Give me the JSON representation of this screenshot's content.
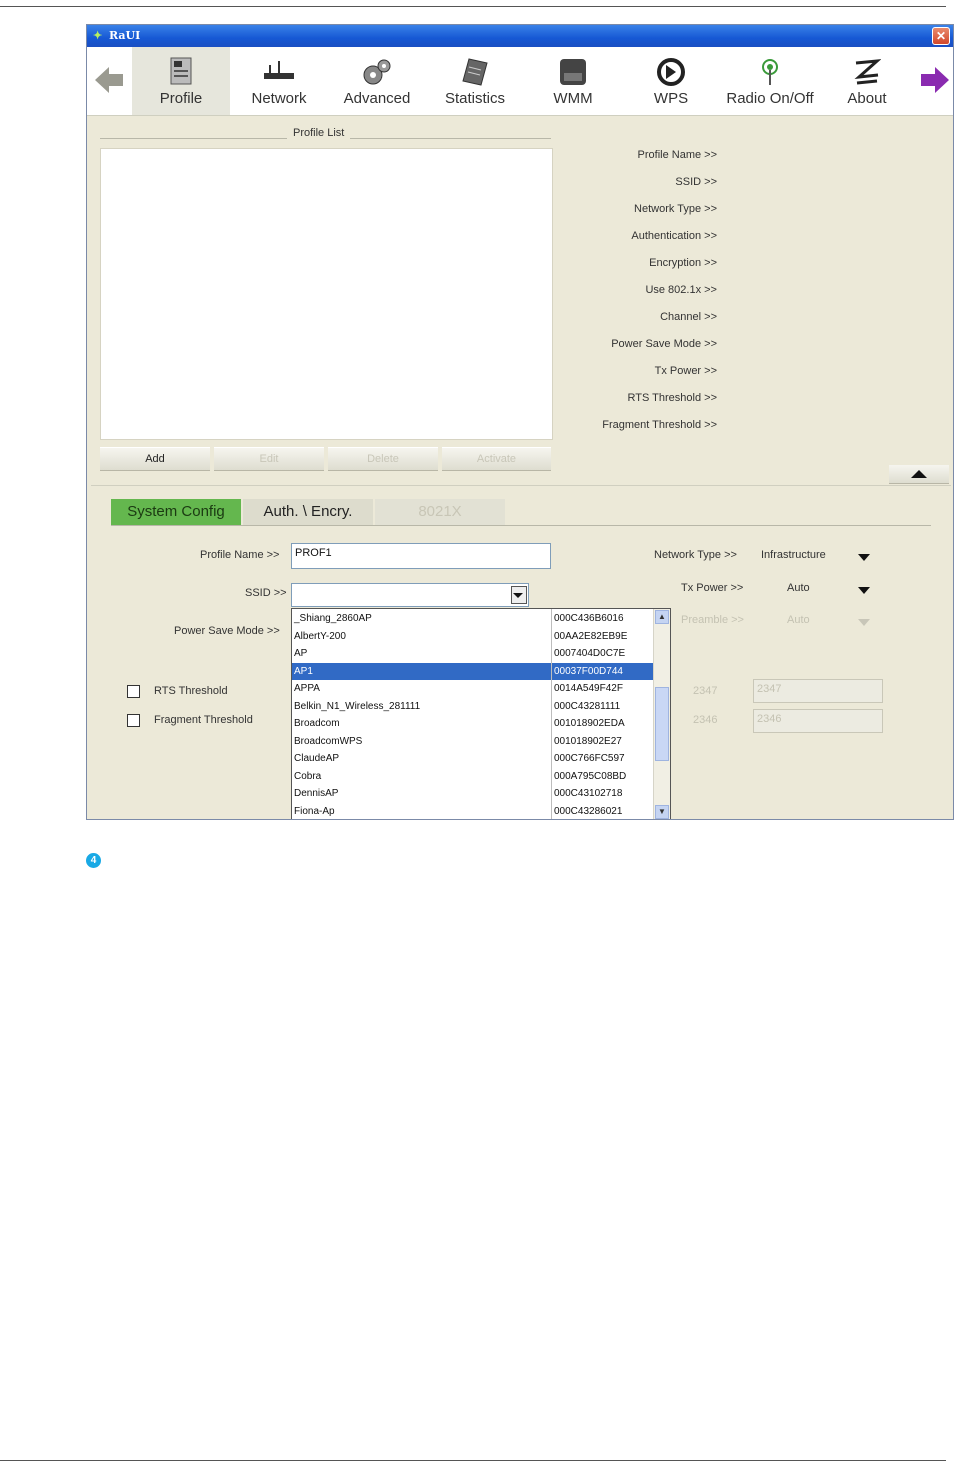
{
  "window": {
    "title": "RaUI",
    "close_label": "✕"
  },
  "toolbar": {
    "items": [
      {
        "label": "Profile"
      },
      {
        "label": "Network"
      },
      {
        "label": "Advanced"
      },
      {
        "label": "Statistics"
      },
      {
        "label": "WMM"
      },
      {
        "label": "WPS"
      },
      {
        "label": "Radio On/Off"
      },
      {
        "label": "About"
      }
    ]
  },
  "profile_list": {
    "title": "Profile List",
    "buttons": {
      "add": "Add",
      "edit": "Edit",
      "delete": "Delete",
      "activate": "Activate"
    }
  },
  "profile_info": {
    "labels": [
      "Profile Name >>",
      "SSID >>",
      "Network Type >>",
      "Authentication >>",
      "Encryption >>",
      "Use 802.1x >>",
      "Channel >>",
      "Power Save Mode >>",
      "Tx Power >>",
      "RTS Threshold >>",
      "Fragment Threshold >>"
    ]
  },
  "tabs": {
    "system_config": "System Config",
    "auth_encry": "Auth. \\ Encry.",
    "x8021x": "8021X"
  },
  "config": {
    "profile_name_label": "Profile Name >>",
    "profile_name_value": "PROF1",
    "ssid_label": "SSID >>",
    "ssid_value": "",
    "power_save_label": "Power Save Mode >>",
    "network_type_label": "Network Type >>",
    "network_type_value": "Infrastructure",
    "tx_power_label": "Tx Power >>",
    "tx_power_value": "Auto",
    "preamble_label": "Preamble >>",
    "preamble_value": "Auto",
    "rts_label": "RTS Threshold",
    "rts_side": "2347",
    "rts_value": "2347",
    "frag_label": "Fragment Threshold",
    "frag_side": "2346",
    "frag_value": "2346"
  },
  "ssid_dropdown": {
    "rows": [
      {
        "name": "_Shiang_2860AP",
        "mac": "000C436B6016"
      },
      {
        "name": "AlbertY-200",
        "mac": "00AA2E82EB9E"
      },
      {
        "name": "AP",
        "mac": "0007404D0C7E"
      },
      {
        "name": "AP1",
        "mac": "00037F00D744"
      },
      {
        "name": "APPA",
        "mac": "0014A549F42F"
      },
      {
        "name": "Belkin_N1_Wireless_281111",
        "mac": "000C43281111"
      },
      {
        "name": "Broadcom",
        "mac": "001018902EDA"
      },
      {
        "name": "BroadcomWPS",
        "mac": "001018902E27"
      },
      {
        "name": "ClaudeAP",
        "mac": "000C766FC597"
      },
      {
        "name": "Cobra",
        "mac": "000A795C08BD"
      },
      {
        "name": "DennisAP",
        "mac": "000C43102718"
      },
      {
        "name": "Fiona-Ap",
        "mac": "000C43286021"
      }
    ],
    "selected_index": 3
  },
  "step_badge": "4"
}
